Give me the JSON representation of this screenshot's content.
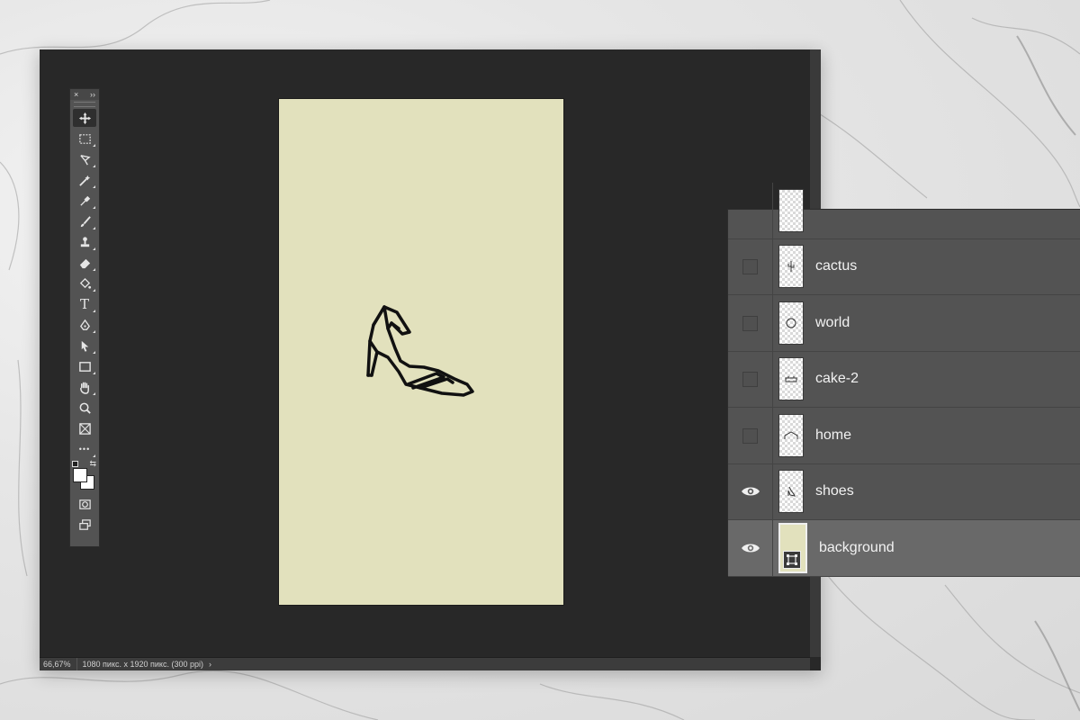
{
  "status_bar": {
    "zoom": "66,67%",
    "doc_info": "1080 пикс. x 1920 пикс. (300 ppi)",
    "arrow": "›"
  },
  "toolbar": {
    "close_label": "×",
    "collapse_label": "››",
    "tools": [
      "move-icon",
      "marquee-icon",
      "lasso-icon",
      "magic-wand-icon",
      "eyedropper-icon",
      "brush-icon",
      "stamp-icon",
      "eraser-icon",
      "paint-bucket-icon",
      "type-icon",
      "pen-icon",
      "path-select-icon",
      "rectangle-icon",
      "hand-icon",
      "zoom-icon",
      "frame-icon",
      "more-icon"
    ],
    "type_tool_label": "T",
    "more_label": "•••",
    "swap_label": "⇆",
    "foreground_color": "#ffffff",
    "background_color": "#ffffff"
  },
  "canvas": {
    "color": "#e2e1bd",
    "artwork": "shoe"
  },
  "layers": {
    "items": [
      {
        "name": "cactus",
        "visible": false
      },
      {
        "name": "world",
        "visible": false
      },
      {
        "name": "cake-2",
        "visible": false
      },
      {
        "name": "home",
        "visible": false
      },
      {
        "name": "shoes",
        "visible": true
      },
      {
        "name": "background",
        "visible": true,
        "selected": true
      }
    ]
  }
}
